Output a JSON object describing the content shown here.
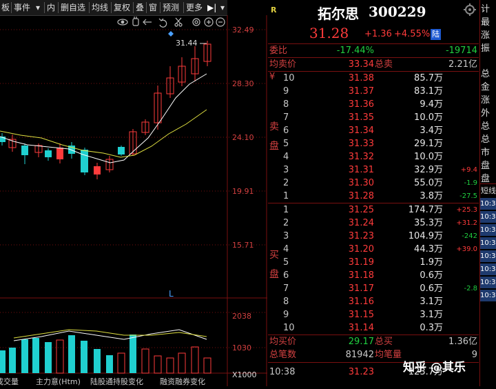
{
  "toolbar": {
    "items": [
      "板",
      "事件",
      "▾",
      "内",
      "删自选",
      "均线",
      "复权",
      "叠",
      "窗",
      "预测",
      "更多",
      "▶|",
      "▾"
    ]
  },
  "chart": {
    "price_ticks": [
      "32.49",
      "28.30",
      "24.10",
      "19.91",
      "15.71"
    ],
    "vol_ticks": [
      "2038",
      "1030"
    ],
    "vol_unit": "X1000",
    "high_label": "31.44",
    "marker_L": "L",
    "bottom_tabs": [
      "成交量",
      "主力意(Htm)",
      "陆股通持股变化",
      "融资融券变化"
    ],
    "icons": [
      "eye-icon",
      "hand-icon",
      "left-arrow-icon",
      "undo-icon",
      "scissors-icon",
      "settings-icon",
      "zoom-in-icon",
      "zoom-out-icon"
    ]
  },
  "quote": {
    "badge": "R",
    "name": "拓尔思",
    "code": "300229",
    "price": "31.28",
    "change": "+1.36",
    "pct": "+4.55%",
    "lu": "陆",
    "webi_label": "委比",
    "webi_value": "-17.44%",
    "webi_diff": "-19714",
    "avg_sell_label": "均卖价",
    "avg_sell_value": "33.34",
    "total_sell_label": "总卖",
    "total_sell_value": "2.21亿",
    "sell_side": "卖盘",
    "buy_side": "买盘",
    "yen": "¥",
    "sell": [
      {
        "lvl": "10",
        "price": "31.38",
        "vol": "85.7万",
        "chg": ""
      },
      {
        "lvl": "9",
        "price": "31.37",
        "vol": "83.1万",
        "chg": ""
      },
      {
        "lvl": "8",
        "price": "31.36",
        "vol": "9.4万",
        "chg": ""
      },
      {
        "lvl": "7",
        "price": "31.35",
        "vol": "10.0万",
        "chg": ""
      },
      {
        "lvl": "6",
        "price": "31.34",
        "vol": "3.4万",
        "chg": ""
      },
      {
        "lvl": "5",
        "price": "31.33",
        "vol": "29.1万",
        "chg": ""
      },
      {
        "lvl": "4",
        "price": "31.32",
        "vol": "10.0万",
        "chg": ""
      },
      {
        "lvl": "3",
        "price": "31.31",
        "vol": "32.9万",
        "chg": "+9.4"
      },
      {
        "lvl": "2",
        "price": "31.30",
        "vol": "55.0万",
        "chg": "-1.9"
      },
      {
        "lvl": "1",
        "price": "31.28",
        "vol": "3.8万",
        "chg": "-27.5"
      }
    ],
    "buy": [
      {
        "lvl": "1",
        "price": "31.25",
        "vol": "174.7万",
        "chg": "+25.3"
      },
      {
        "lvl": "2",
        "price": "31.24",
        "vol": "35.3万",
        "chg": "+31.2"
      },
      {
        "lvl": "3",
        "price": "31.23",
        "vol": "104.9万",
        "chg": "-242"
      },
      {
        "lvl": "4",
        "price": "31.20",
        "vol": "44.3万",
        "chg": "+39.0"
      },
      {
        "lvl": "5",
        "price": "31.19",
        "vol": "1.9万",
        "chg": ""
      },
      {
        "lvl": "6",
        "price": "31.18",
        "vol": "0.6万",
        "chg": ""
      },
      {
        "lvl": "7",
        "price": "31.17",
        "vol": "0.6万",
        "chg": "-2.8"
      },
      {
        "lvl": "8",
        "price": "31.16",
        "vol": "3.1万",
        "chg": ""
      },
      {
        "lvl": "9",
        "price": "31.15",
        "vol": "3.1万",
        "chg": ""
      },
      {
        "lvl": "10",
        "price": "31.14",
        "vol": "0.3万",
        "chg": ""
      }
    ],
    "avg_buy_label": "均买价",
    "avg_buy_value": "29.17",
    "total_buy_label": "总买",
    "total_buy_value": "1.36亿",
    "trades_label": "总笔数",
    "trades_value": "81942",
    "avg_lot_label": "均笔量",
    "avg_lot_value": "9",
    "tick_time": "10:38",
    "tick_price": "31.23",
    "tick_vol": "123.7万"
  },
  "edge": {
    "labels": [
      "计",
      "最",
      "涨",
      "振",
      "总",
      "金",
      "涨",
      "外",
      "总",
      "总",
      "市",
      "盘",
      "盘"
    ],
    "short": "短线",
    "rows": [
      "10:3",
      "10:3",
      "10:3",
      "10:3",
      "10:3",
      "10:3",
      "10:3",
      "10:3"
    ]
  },
  "watermark": "知乎 @其乐",
  "colors": {
    "up": "#ff3b3b",
    "down": "#20d0d0",
    "ma5": "#ffffff",
    "ma10": "#e0e040",
    "grid": "#7a1010"
  }
}
